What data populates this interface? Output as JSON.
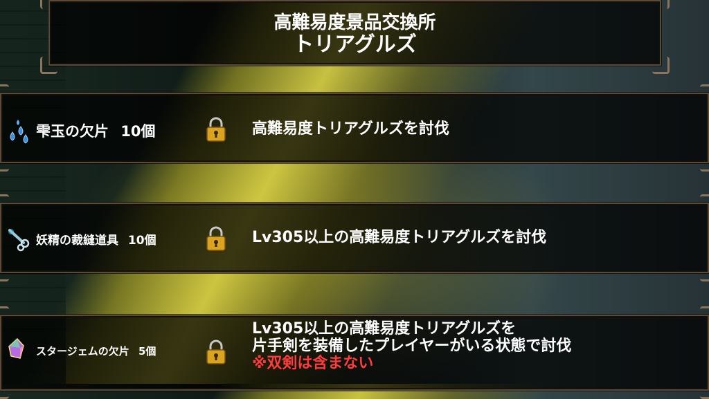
{
  "header": {
    "title_line1": "高難易度景品交換所",
    "title_line2": "トリアグルズ"
  },
  "rewards": [
    {
      "item": "雫玉の欠片",
      "quantity": "10個",
      "icon": "water-drops-icon",
      "condition_lines": [
        "高難易度トリアグルズを討伐"
      ]
    },
    {
      "item": "妖精の裁縫道具",
      "quantity": "10個",
      "icon": "sewing-tool-icon",
      "condition_lines": [
        "Lv305以上の高難易度トリアグルズを討伐"
      ]
    },
    {
      "item": "スタージェムの欠片",
      "quantity": "5個",
      "icon": "star-gem-icon",
      "condition_lines": [
        "Lv305以上の高難易度トリアグルズを",
        "片手剣を装備したプレイヤーがいる状態で討伐"
      ],
      "condition_note": "※双剣は含まない"
    }
  ],
  "colors": {
    "frame": "#8a7560",
    "note": "#ff3b3b",
    "lock_gold": "#d9a520"
  }
}
